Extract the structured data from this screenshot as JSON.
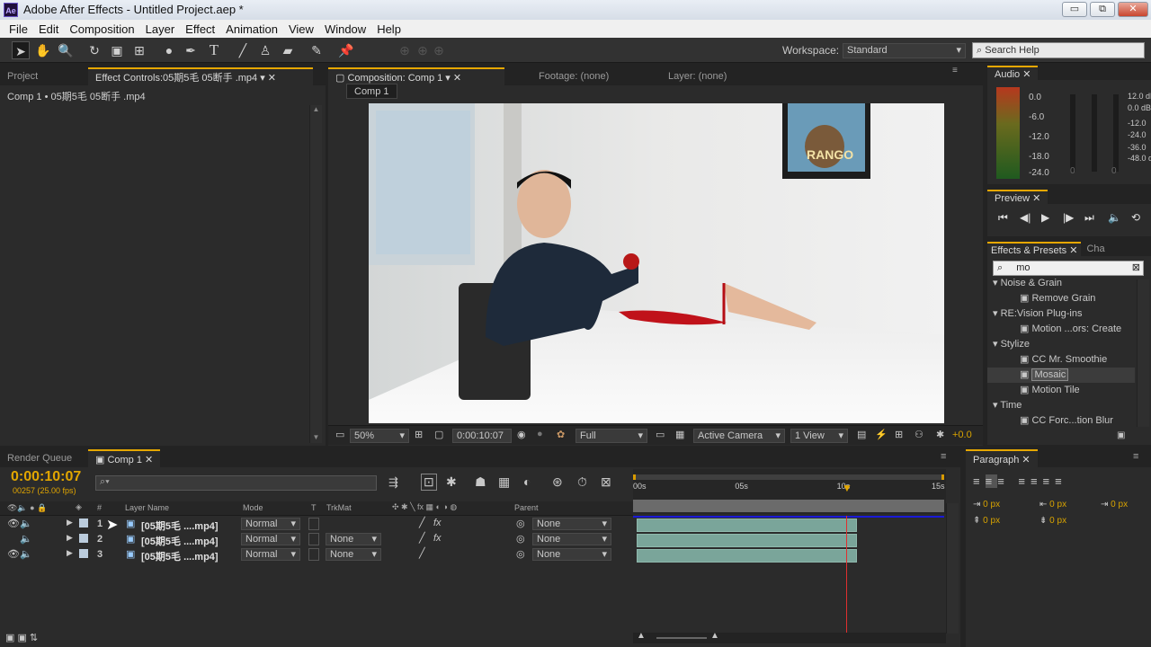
{
  "window": {
    "title": "Adobe After Effects - Untitled Project.aep *",
    "app_icon": "Ae",
    "minimize": "▭",
    "restore": "⧉",
    "close": "✕"
  },
  "menu": [
    "File",
    "Edit",
    "Composition",
    "Layer",
    "Effect",
    "Animation",
    "View",
    "Window",
    "Help"
  ],
  "toolbar": {
    "workspace_label": "Workspace:",
    "workspace_value": "Standard",
    "search_placeholder": "Search Help"
  },
  "left_panel": {
    "tab_project": "Project",
    "tab_effect_controls": "Effect Controls:05期5毛 05断手 .mp4",
    "breadcrumb": "Comp 1 • 05期5毛 05断手 .mp4"
  },
  "comp_panel": {
    "tab_composition": "Composition: Comp 1",
    "tab_footage": "Footage: (none)",
    "tab_layer": "Layer: (none)",
    "subtab": "Comp 1",
    "poster_text": "RANGO",
    "zoom": "50%",
    "timecode": "0:00:10:07",
    "resolution": "Full",
    "camera": "Active Camera",
    "view": "1 View",
    "exposure": "+0.0"
  },
  "audio_panel": {
    "tab": "Audio",
    "db_left": [
      "0.0",
      "-6.0",
      "-12.0",
      "-18.0",
      "-24.0"
    ],
    "db_right": [
      "12.0 dB",
      "0.0 dB",
      "-12.0",
      "-24.0",
      "-36.0",
      "-48.0 dB"
    ],
    "zero_a": "0",
    "zero_b": "0"
  },
  "preview_panel": {
    "tab": "Preview"
  },
  "effects_panel": {
    "tab": "Effects & Presets",
    "tab2": "Cha",
    "search_value": "mo",
    "items": [
      {
        "type": "cat",
        "label": "Noise & Grain"
      },
      {
        "type": "fx",
        "label": "Remove Grain"
      },
      {
        "type": "cat",
        "label": "RE:Vision Plug-ins"
      },
      {
        "type": "fx",
        "label": "Motion ...ors: Create"
      },
      {
        "type": "cat",
        "label": "Stylize"
      },
      {
        "type": "fx",
        "label": "CC Mr. Smoothie"
      },
      {
        "type": "fx",
        "label": "Mosaic"
      },
      {
        "type": "fx",
        "label": "Motion Tile"
      },
      {
        "type": "cat",
        "label": "Time"
      },
      {
        "type": "fx",
        "label": "CC Forc...tion Blur"
      }
    ]
  },
  "paragraph_panel": {
    "tab": "Paragraph",
    "px_values": [
      "0 px",
      "0 px",
      "0 px",
      "0 px",
      "0 px"
    ]
  },
  "timeline": {
    "tab_render": "Render Queue",
    "tab_comp": "Comp 1",
    "timecode": "0:00:10:07",
    "frames": "00257 (25.00 fps)",
    "col_num": "#",
    "col_layer": "Layer Name",
    "col_mode": "Mode",
    "col_t": "T",
    "col_trkmat": "TrkMat",
    "col_parent": "Parent",
    "ruler": [
      "00s",
      "05s",
      "10s",
      "15s"
    ],
    "layers": [
      {
        "num": "1",
        "name": "[05期5毛 ....mp4]",
        "mode": "Normal",
        "trkmat": "",
        "parent": "None",
        "fx": "fx"
      },
      {
        "num": "2",
        "name": "[05期5毛 ....mp4]",
        "mode": "Normal",
        "trkmat": "None",
        "parent": "None",
        "fx": "fx"
      },
      {
        "num": "3",
        "name": "[05期5毛 ....mp4]",
        "mode": "Normal",
        "trkmat": "None",
        "parent": "None",
        "fx": ""
      }
    ],
    "playhead_seconds": 10.28,
    "duration_seconds": 15
  }
}
